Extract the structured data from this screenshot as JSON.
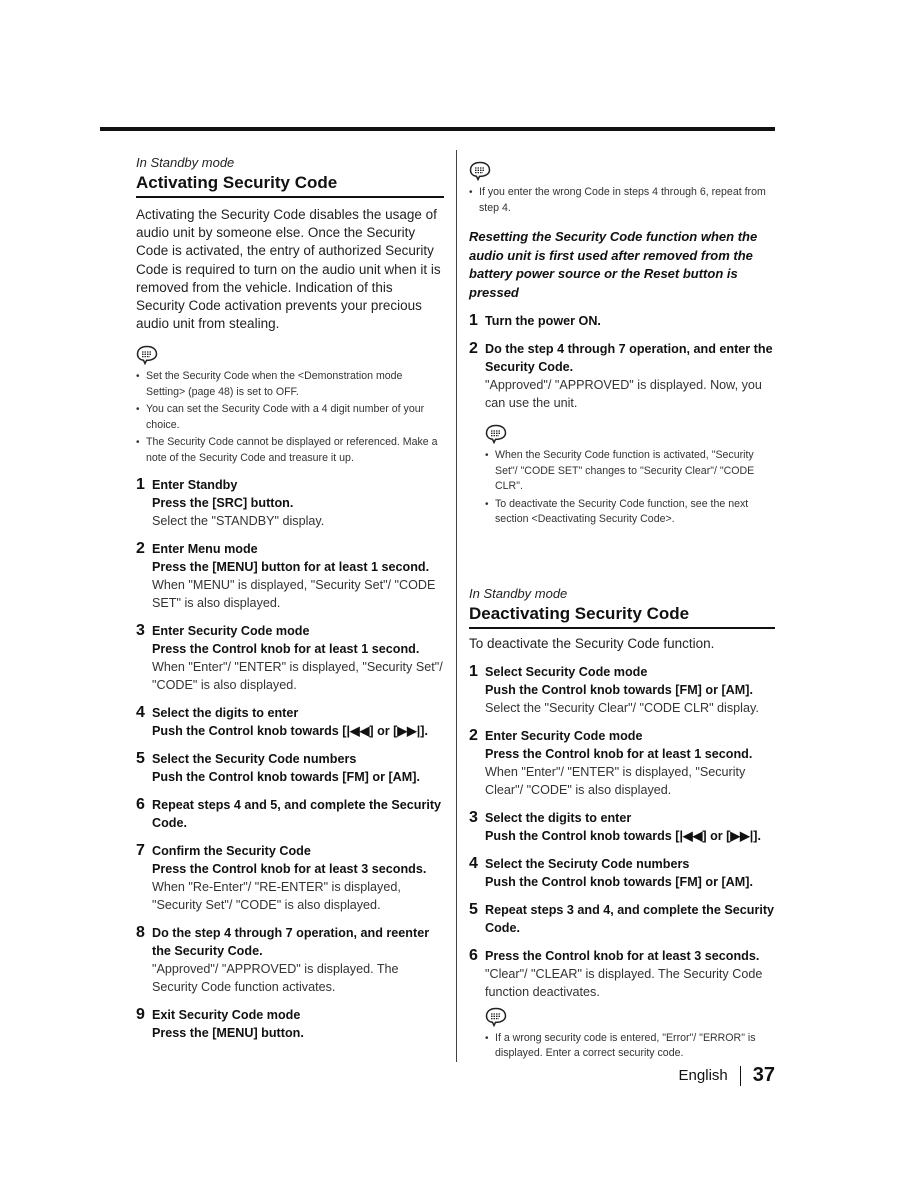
{
  "page": {
    "footer": {
      "language": "English",
      "page_number": "37"
    }
  },
  "left": {
    "mode_label": "In Standby mode",
    "title": "Activating Security Code",
    "intro": "Activating the Security Code disables the usage of audio unit by someone else. Once the Security Code is activated, the entry of authorized Security Code is required to turn on the audio unit when it is removed from the vehicle. Indication of this Security Code activation prevents  your precious audio unit from stealing.",
    "note_icon": "speech-bubble-note-icon",
    "notes": [
      "Set the Security Code when the <Demonstration mode Setting> (page 48) is set to OFF.",
      "You can set the Security Code with a 4 digit number of your choice.",
      "The Security Code cannot be displayed or referenced. Make a note of the Security Code and treasure it up."
    ],
    "steps": [
      {
        "num": "1",
        "title": "Enter Standby",
        "action": "Press the [SRC] button.",
        "desc": "Select the \"STANDBY\" display."
      },
      {
        "num": "2",
        "title": "Enter Menu mode",
        "action": "Press the [MENU] button for at least 1 second.",
        "desc": "When \"MENU\" is displayed, \"Security Set\"/ \"CODE SET\" is also displayed."
      },
      {
        "num": "3",
        "title": "Enter Security Code mode",
        "action": "Press the Control knob for at least 1 second.",
        "desc": "When \"Enter\"/ \"ENTER\" is displayed, \"Security Set\"/ \"CODE\" is also displayed."
      },
      {
        "num": "4",
        "title": "Select the digits to enter",
        "action": "Push the Control knob towards [|◀◀] or [▶▶|].",
        "desc": ""
      },
      {
        "num": "5",
        "title": "Select the Security Code numbers",
        "action": "Push the Control knob towards [FM] or [AM].",
        "desc": ""
      },
      {
        "num": "6",
        "title": "Repeat steps 4 and 5, and complete the Security Code.",
        "action": "",
        "desc": ""
      },
      {
        "num": "7",
        "title": "Confirm the Security Code",
        "action": "Press the Control knob for at least 3 seconds.",
        "desc": "When \"Re-Enter\"/ \"RE-ENTER\" is displayed, \"Security Set\"/ \"CODE\" is also displayed."
      },
      {
        "num": "8",
        "title": "Do the step 4 through 7 operation, and reenter the Security Code.",
        "action": "",
        "desc": "\"Approved\"/ \"APPROVED\" is displayed. The Security Code function activates."
      },
      {
        "num": "9",
        "title": "Exit Security Code mode",
        "action": "Press the [MENU] button.",
        "desc": ""
      }
    ]
  },
  "right": {
    "top_note": "If you enter the wrong Code in steps 4 through 6, repeat from step 4.",
    "reset_heading": "Resetting the Security Code function when the audio unit is first used after removed from the battery power source or the Reset button is pressed",
    "reset_steps": [
      {
        "num": "1",
        "title": "Turn the power ON.",
        "action": "",
        "desc": ""
      },
      {
        "num": "2",
        "title": "Do the step 4 through 7 operation, and enter the Security Code.",
        "action": "",
        "desc": "\"Approved\"/ \"APPROVED\" is displayed. Now, you can use the unit."
      }
    ],
    "reset_notes": [
      "When the Security Code function is activated, \"Security Set\"/ \"CODE SET\" changes to \"Security Clear\"/ \"CODE CLR\".",
      "To deactivate the Security Code function, see the next section <Deactivating Security Code>."
    ],
    "deactivate": {
      "mode_label": "In Standby mode",
      "title": "Deactivating Security Code",
      "intro": "To deactivate the Security Code function.",
      "steps": [
        {
          "num": "1",
          "title": "Select Security Code mode",
          "action": "Push the Control knob towards [FM] or [AM].",
          "desc": "Select the \"Security Clear\"/ \"CODE CLR\" display."
        },
        {
          "num": "2",
          "title": "Enter Security Code mode",
          "action": "Press the Control knob for at least 1 second.",
          "desc": "When \"Enter\"/ \"ENTER\" is displayed, \"Security Clear\"/ \"CODE\" is also displayed."
        },
        {
          "num": "3",
          "title": "Select the digits to enter",
          "action": "Push the Control knob towards [|◀◀] or [▶▶|].",
          "desc": ""
        },
        {
          "num": "4",
          "title": "Select the Seciruty Code numbers",
          "action": "Push the Control knob towards [FM] or [AM].",
          "desc": ""
        },
        {
          "num": "5",
          "title": "Repeat steps 3 and 4, and complete the Security Code.",
          "action": "",
          "desc": ""
        },
        {
          "num": "6",
          "title": "Press the Control knob for at least 3 seconds.",
          "action": "",
          "desc": "\"Clear\"/ \"CLEAR\" is displayed. The Security Code function deactivates."
        }
      ],
      "notes": [
        "If a wrong security code is entered, \"Error\"/ \"ERROR\" is displayed. Enter a correct security code."
      ]
    }
  }
}
